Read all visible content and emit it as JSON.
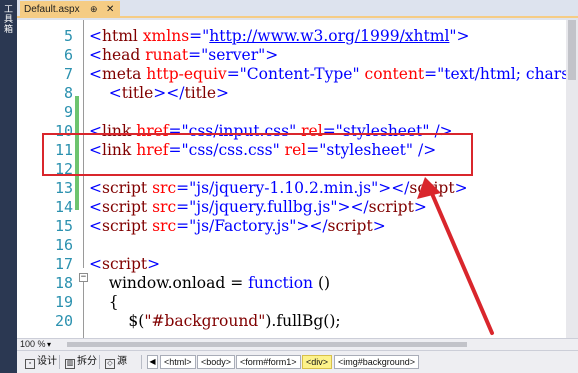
{
  "toolbox": {
    "label": "工具箱"
  },
  "tab": {
    "title": "Default.aspx",
    "pin": "⊕",
    "close": "✕"
  },
  "editor": {
    "lines": [
      {
        "num": "5",
        "tokens": [
          [
            "b",
            "<"
          ],
          [
            "t",
            "html"
          ],
          [
            "p",
            " "
          ],
          [
            "a",
            "xmlns"
          ],
          [
            "b",
            "=\""
          ],
          [
            "u",
            "http://www.w3.org/1999/xhtml"
          ],
          [
            "b",
            "\">"
          ]
        ]
      },
      {
        "num": "6",
        "tokens": [
          [
            "b",
            "<"
          ],
          [
            "t",
            "head"
          ],
          [
            "p",
            " "
          ],
          [
            "a",
            "runat"
          ],
          [
            "b",
            "=\"server\">"
          ]
        ]
      },
      {
        "num": "7",
        "tokens": [
          [
            "b",
            "<"
          ],
          [
            "t",
            "meta"
          ],
          [
            "p",
            " "
          ],
          [
            "a",
            "http-equiv"
          ],
          [
            "b",
            "=\"Content-Type\""
          ],
          [
            "p",
            " "
          ],
          [
            "a",
            "content"
          ],
          [
            "b",
            "=\"text/html; chars"
          ]
        ]
      },
      {
        "num": "8",
        "tokens": [
          [
            "p",
            "    "
          ],
          [
            "b",
            "<"
          ],
          [
            "t",
            "title"
          ],
          [
            "b",
            "></"
          ],
          [
            "t",
            "title"
          ],
          [
            "b",
            ">"
          ]
        ]
      },
      {
        "num": "9",
        "tokens": []
      },
      {
        "num": "10",
        "tokens": [
          [
            "b",
            "<"
          ],
          [
            "t",
            "link"
          ],
          [
            "p",
            " "
          ],
          [
            "a",
            "href"
          ],
          [
            "b",
            "=\"css/input.css\""
          ],
          [
            "p",
            " "
          ],
          [
            "a",
            "rel"
          ],
          [
            "b",
            "=\"stylesheet\""
          ],
          [
            "p",
            " "
          ],
          [
            "b",
            "/>"
          ]
        ]
      },
      {
        "num": "11",
        "tokens": [
          [
            "b",
            "<"
          ],
          [
            "t",
            "link"
          ],
          [
            "p",
            " "
          ],
          [
            "a",
            "href"
          ],
          [
            "b",
            "=\"css/css.css\""
          ],
          [
            "p",
            " "
          ],
          [
            "a",
            "rel"
          ],
          [
            "b",
            "=\"stylesheet\""
          ],
          [
            "p",
            " "
          ],
          [
            "b",
            "/>"
          ]
        ]
      },
      {
        "num": "12",
        "tokens": []
      },
      {
        "num": "13",
        "tokens": [
          [
            "b",
            "<"
          ],
          [
            "t",
            "script"
          ],
          [
            "p",
            " "
          ],
          [
            "a",
            "src"
          ],
          [
            "b",
            "=\"js/jquery-1.10.2.min.js\"></"
          ],
          [
            "t",
            "script"
          ],
          [
            "b",
            ">"
          ]
        ]
      },
      {
        "num": "14",
        "tokens": [
          [
            "b",
            "<"
          ],
          [
            "t",
            "script"
          ],
          [
            "p",
            " "
          ],
          [
            "a",
            "src"
          ],
          [
            "b",
            "=\"js/jquery.fullbg.js\"></"
          ],
          [
            "t",
            "script"
          ],
          [
            "b",
            ">"
          ]
        ]
      },
      {
        "num": "15",
        "tokens": [
          [
            "b",
            "<"
          ],
          [
            "t",
            "script"
          ],
          [
            "p",
            " "
          ],
          [
            "a",
            "src"
          ],
          [
            "b",
            "=\"js/Factory.js\"></"
          ],
          [
            "t",
            "script"
          ],
          [
            "b",
            ">"
          ]
        ]
      },
      {
        "num": "16",
        "tokens": []
      },
      {
        "num": "17",
        "tokens": [
          [
            "b",
            "<"
          ],
          [
            "t",
            "script"
          ],
          [
            "b",
            ">"
          ]
        ]
      },
      {
        "num": "18",
        "tokens": [
          [
            "p",
            "    window.onload = "
          ],
          [
            "k",
            "function"
          ],
          [
            "p",
            " ()"
          ]
        ]
      },
      {
        "num": "19",
        "tokens": [
          [
            "p",
            "    {"
          ]
        ]
      },
      {
        "num": "20",
        "tokens": [
          [
            "p",
            "        $("
          ],
          [
            "t",
            "\"#background\""
          ],
          [
            "p",
            ").fullBg();"
          ]
        ]
      }
    ]
  },
  "zoom": {
    "level": "100 %",
    "caret": "▾"
  },
  "views": {
    "design": "设计",
    "split": "拆分",
    "source": "源"
  },
  "breadcrumbs": [
    "<html>",
    "<body>",
    "<form#form1>",
    "<div>",
    "<img#background>"
  ],
  "colors": {
    "highlight": "#d9262c",
    "changebar": "#6ec46e",
    "selected_crumb": "#fdf28a",
    "tab": "#f5cc84"
  }
}
